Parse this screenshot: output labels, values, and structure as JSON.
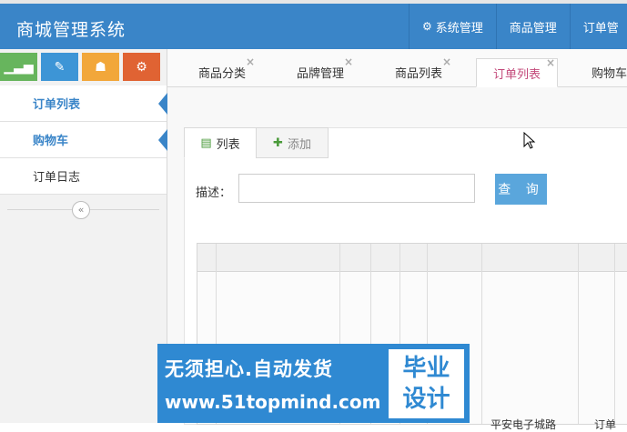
{
  "header": {
    "app_title": "商城管理系统",
    "nav": [
      {
        "label": "系统管理",
        "icon": "gears-icon"
      },
      {
        "label": "商品管理"
      },
      {
        "label": "订单管"
      }
    ]
  },
  "sidebar": {
    "quick_buttons": [
      {
        "icon": "bar-chart-icon",
        "color": "#67b55d"
      },
      {
        "icon": "pencil-icon",
        "color": "#3d95d6"
      },
      {
        "icon": "users-icon",
        "color": "#f2a73a"
      },
      {
        "icon": "cogs-icon",
        "color": "#e06333"
      }
    ],
    "items": [
      {
        "label": "订单列表"
      },
      {
        "label": "购物车"
      },
      {
        "label": "订单日志"
      }
    ],
    "collapse_icon": "«"
  },
  "tabs": [
    {
      "label": "商品分类"
    },
    {
      "label": "品牌管理"
    },
    {
      "label": "商品列表"
    },
    {
      "label": "订单列表"
    },
    {
      "label": "购物车"
    }
  ],
  "subtabs": [
    {
      "label": "列表",
      "icon": "list-icon"
    },
    {
      "label": "添加",
      "icon": "plus-icon"
    }
  ],
  "search": {
    "label": "描述：",
    "value": "",
    "button_label": "查 询"
  },
  "grid": {
    "partial_cells": [
      "平安电子城路",
      "订单"
    ]
  },
  "watermark": {
    "line1": "无须担心.自动发货",
    "line2": "www.51topmind.com",
    "box_line1": "毕业",
    "box_line2": "设计"
  }
}
